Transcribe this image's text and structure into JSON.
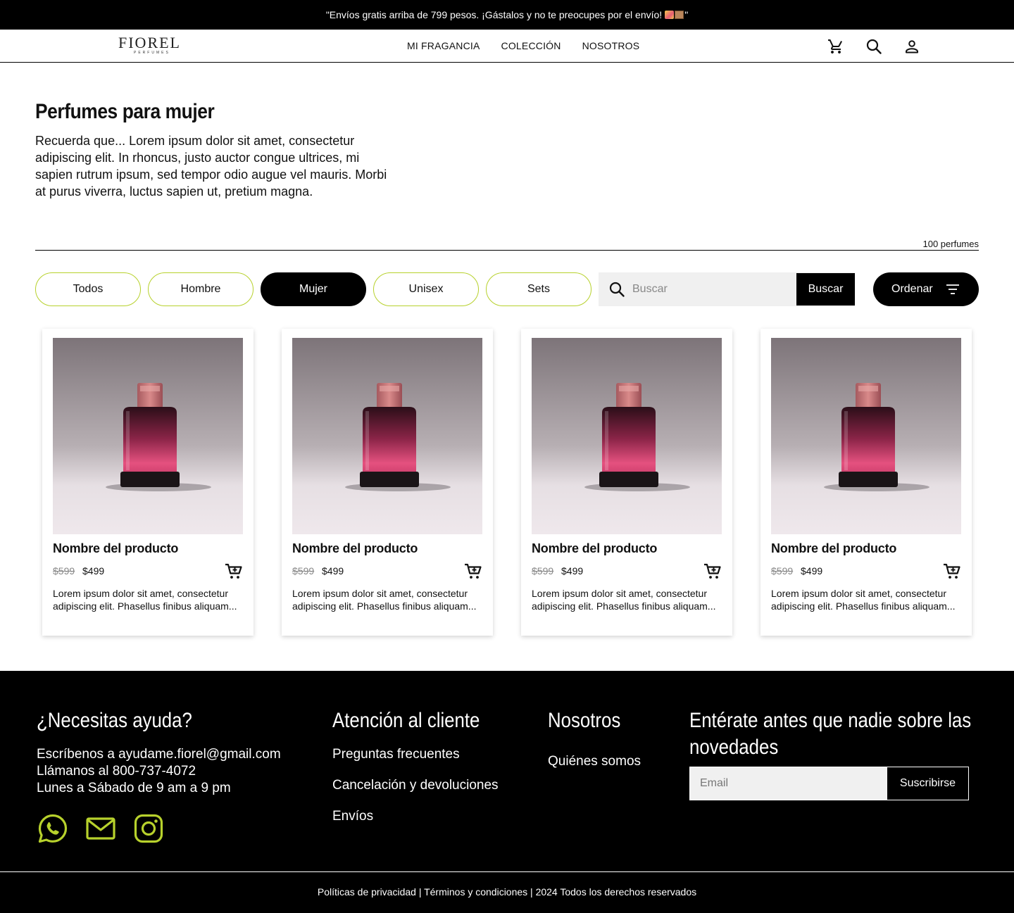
{
  "banner": {
    "text": "\"Envíos gratis arriba de 799 pesos. ¡Gástalos y no te preocupes por el envío!",
    "closing": "\""
  },
  "header": {
    "logo_name": "FIOREL",
    "logo_sub": "PERFUMES",
    "nav": [
      "MI FRAGANCIA",
      "COLECCIÓN",
      "NOSOTROS"
    ],
    "icons": [
      "cart-icon",
      "search-icon",
      "user-icon"
    ]
  },
  "intro": {
    "title": "Perfumes para mujer",
    "text": "Recuerda que...  Lorem ipsum dolor sit amet, consectetur adipiscing elit. In rhoncus, justo auctor congue ultrices, mi sapien rutrum ipsum, sed tempor odio augue vel mauris. Morbi at purus viverra, luctus sapien ut, pretium magna.",
    "count": "100 perfumes"
  },
  "filters": {
    "pills": [
      {
        "label": "Todos",
        "active": false
      },
      {
        "label": "Hombre",
        "active": false
      },
      {
        "label": "Mujer",
        "active": true
      },
      {
        "label": "Unisex",
        "active": false
      },
      {
        "label": "Sets",
        "active": false
      }
    ],
    "search_placeholder": "Buscar",
    "search_button": "Buscar",
    "order_label": "Ordenar"
  },
  "products": [
    {
      "name": "Nombre del producto",
      "old_price": "$599",
      "price": "$499",
      "desc": "Lorem ipsum dolor sit amet, consectetur adipiscing elit. Phasellus finibus aliquam..."
    },
    {
      "name": "Nombre del producto",
      "old_price": "$599",
      "price": "$499",
      "desc": "Lorem ipsum dolor sit amet, consectetur adipiscing elit. Phasellus finibus aliquam..."
    },
    {
      "name": "Nombre del producto",
      "old_price": "$599",
      "price": "$499",
      "desc": "Lorem ipsum dolor sit amet, consectetur adipiscing elit. Phasellus finibus aliquam..."
    },
    {
      "name": "Nombre del producto",
      "old_price": "$599",
      "price": "$499",
      "desc": "Lorem ipsum dolor sit amet, consectetur adipiscing elit. Phasellus finibus aliquam..."
    }
  ],
  "footer": {
    "help": {
      "title": "¿Necesitas ayuda?",
      "lines": [
        "Escríbenos a ayudame.fiorel@gmail.com",
        "Llámanos al 800-737-4072",
        "Lunes a Sábado de 9 am a 9 pm"
      ]
    },
    "service": {
      "title": "Atención al cliente",
      "links": [
        "Preguntas frecuentes",
        "Cancelación y devoluciones",
        "Envíos"
      ]
    },
    "about": {
      "title": "Nosotros",
      "links": [
        "Quiénes somos"
      ]
    },
    "newsletter": {
      "title_line1": "Entérate antes que nadie sobre las",
      "title_line2": "novedades",
      "email_placeholder": "Email",
      "button": "Suscribirse"
    },
    "social_icons": [
      "whatsapp-icon",
      "mail-icon",
      "instagram-icon"
    ],
    "legal": "Políticas de privacidad | Términos y condiciones | 2024 Todos los derechos reservados"
  },
  "colors": {
    "accent": "#b7d12c",
    "black": "#000000",
    "bottle": "#d94a7a"
  }
}
